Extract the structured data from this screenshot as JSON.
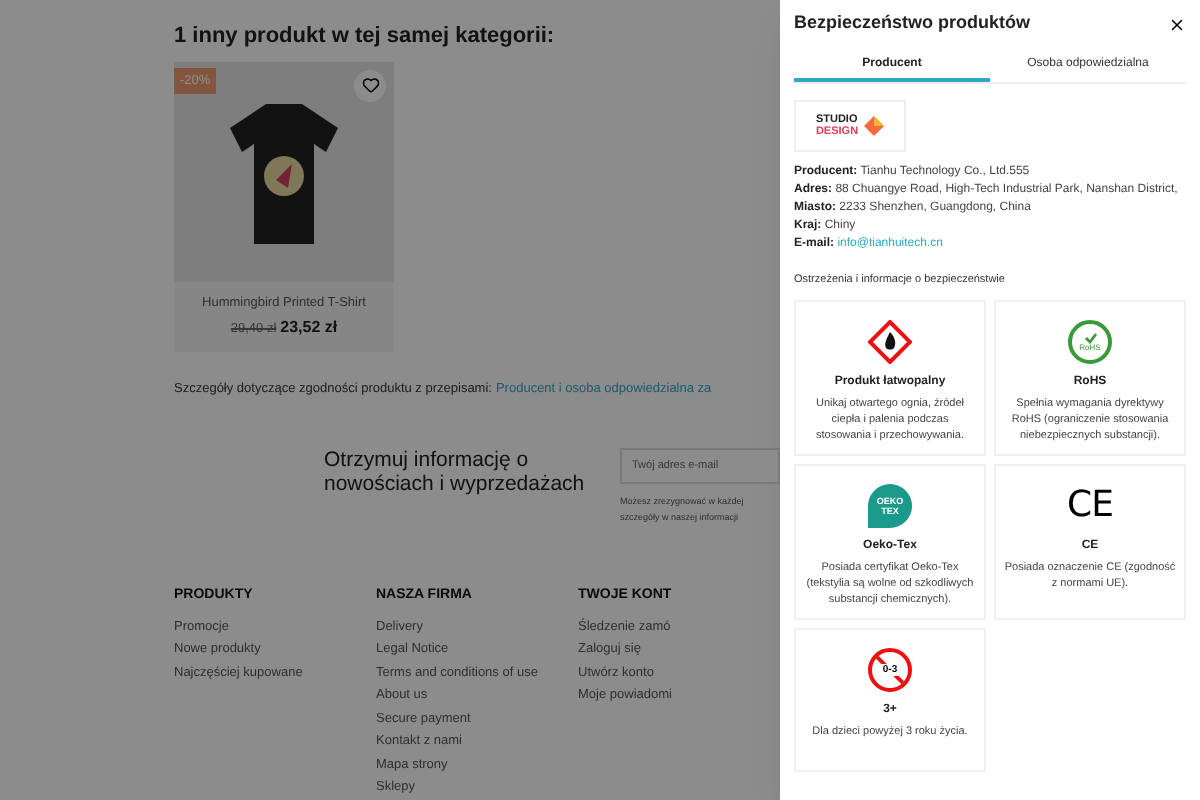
{
  "page": {
    "heading": "1 inny produkt w tej samej kategorii:",
    "product": {
      "discount": "-20%",
      "name": "Hummingbird Printed T-Shirt",
      "old_price": "29,40 zł",
      "price": "23,52 zł"
    },
    "compliance": {
      "text": "Szczegóły dotyczące zgodności produktu z przepisami:",
      "link": "Producent i osoba odpowiedzialna za"
    },
    "newsletter": {
      "title": "Otrzymuj informację o nowościach i wyprzedażach",
      "placeholder": "Twój adres e-mail",
      "note": [
        "Możesz zrezygnować w każdej",
        "szczegóły w naszej informacji"
      ]
    },
    "footer_columns": [
      {
        "title": "PRODUKTY",
        "links": [
          "Promocje",
          "Nowe produkty",
          "Najczęściej kupowane"
        ]
      },
      {
        "title": "NASZA FIRMA",
        "links": [
          "Delivery",
          "Legal Notice",
          "Terms and conditions of use",
          "About us",
          "Secure payment",
          "Kontakt z nami",
          "Mapa strony",
          "Sklepy"
        ]
      },
      {
        "title": "TWOJE KONT",
        "links": [
          "Śledzenie zamó",
          "Zaloguj się",
          "Utwórz konto",
          "Moje powiadomi"
        ]
      }
    ]
  },
  "panel": {
    "title": "Bezpieczeństwo produktów",
    "tabs": [
      {
        "label": "Producent",
        "selected": true
      },
      {
        "label": "Osoba odpowiedzialna",
        "selected": false
      }
    ],
    "logo": {
      "line_1": "STUDIO",
      "line_2": "DESIGN"
    },
    "details": [
      {
        "label": "Producent:",
        "value": "Tianhu Technology Co., Ltd.555",
        "kind": "text"
      },
      {
        "label": "Adres:",
        "value": "88 Chuangye Road, High-Tech Industrial Park, Nanshan District,",
        "kind": "text"
      },
      {
        "label": "Miasto:",
        "value": "2233 Shenzhen, Guangdong, China",
        "kind": "text"
      },
      {
        "label": "Kraj:",
        "value": "Chiny",
        "kind": "text"
      },
      {
        "label": "E-mail:",
        "value": "info@tianhuitech.cn",
        "kind": "link"
      }
    ],
    "section_title": "Ostrzeżenia i informacje o bezpieczeństwie",
    "cards": [
      {
        "kind": "flammable",
        "title": "Produkt łatwopalny",
        "text": "Unikaj otwartego ognia, źródeł ciepła i palenia podczas stosowania i przechowywania."
      },
      {
        "kind": "rohs",
        "logo_text": "RoHS",
        "title": "RoHS",
        "text": "Spełnia wymagania dyrektywy RoHS (ograniczenie stosowania niebezpiecznych substancji)."
      },
      {
        "kind": "oeko",
        "logo_text": "OEKO TEX",
        "title": "Oeko-Tex",
        "text": "Posiada certyfikat Oeko-Tex (tekstylia są wolne od szkodliwych substancji chemicznych)."
      },
      {
        "kind": "ce",
        "logo_text": "CE",
        "title": "CE",
        "text": "Posiada oznaczenie CE (zgodność z normami UE)."
      },
      {
        "kind": "age",
        "logo_text": "0-3",
        "title": "3+",
        "text": "Dla dzieci powyżej 3 roku życia."
      }
    ]
  }
}
